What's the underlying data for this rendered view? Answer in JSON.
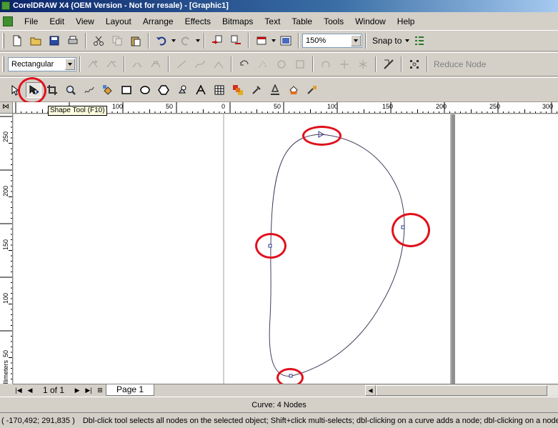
{
  "window": {
    "title": "CorelDRAW X4 (OEM Version - Not for resale) - [Graphic1]"
  },
  "menu": [
    "File",
    "Edit",
    "View",
    "Layout",
    "Arrange",
    "Effects",
    "Bitmaps",
    "Text",
    "Table",
    "Tools",
    "Window",
    "Help"
  ],
  "standard_toolbar": {
    "zoom_level": "150%",
    "snap_to_label": "Snap to"
  },
  "property_bar": {
    "selection_mode": "Rectangular",
    "reduce_nodes_label": "Reduce Node"
  },
  "toolbox": {
    "active_tool": "shape-tool",
    "tooltip": "Shape Tool (F10)",
    "tools": [
      "pick-tool-icon",
      "shape-tool-icon",
      "crop-tool-icon",
      "zoom-tool-icon",
      "freehand-tool-icon",
      "smart-fill-tool-icon",
      "rectangle-tool-icon",
      "ellipse-tool-icon",
      "polygon-tool-icon",
      "basic-shapes-tool-icon",
      "text-tool-icon",
      "table-tool-icon",
      "interactive-blend-tool-icon",
      "eyedropper-tool-icon",
      "outline-tool-icon",
      "fill-tool-icon",
      "interactive-fill-tool-icon"
    ]
  },
  "ruler": {
    "horizontal_labels": [
      "100",
      "50",
      "0",
      "50",
      "100",
      "150",
      "200",
      "250",
      "300"
    ],
    "vertical_labels": [
      "250",
      "200",
      "150",
      "100",
      "50"
    ],
    "unit": "millimeters"
  },
  "drawing": {
    "curve_nodes": 4,
    "highlight_color": "#e0101c",
    "curve_color": "#4a3a5a"
  },
  "document_nav": {
    "page_count_text": "1 of 1",
    "page_tab": "Page 1"
  },
  "status": {
    "object_info": "Curve: 4 Nodes",
    "cursor_position": "( -170,492; 291,835 )",
    "hint": "Dbl-click tool selects all nodes on the selected object; Shift+click multi-selects; dbl-clicking on a curve adds a node; dbl-clicking on a node re"
  }
}
